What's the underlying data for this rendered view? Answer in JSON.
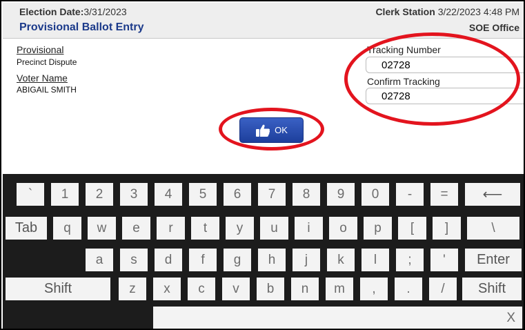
{
  "header": {
    "election_date_label": "Election Date:",
    "election_date_value": "3/31/2023",
    "title": "Provisional Ballot Entry",
    "station_label": "Clerk Station",
    "station_datetime": "3/22/2023 4:48 PM",
    "office": "SOE Office"
  },
  "details": {
    "provisional_label": "Provisional",
    "provisional_value": "Precinct Dispute",
    "voter_label": "Voter Name",
    "voter_value": "ABIGAIL SMITH"
  },
  "tracking": {
    "number_label": "Tracking Number",
    "number_value": "02728",
    "confirm_label": "Confirm Tracking",
    "confirm_value": "02728"
  },
  "ok_button": {
    "label": "OK",
    "icon": "thumbs-up-icon"
  },
  "annotation_color": "#e3141e",
  "keyboard": {
    "row1": [
      "`",
      "1",
      "2",
      "3",
      "4",
      "5",
      "6",
      "7",
      "8",
      "9",
      "0",
      "-",
      "=",
      "⟵"
    ],
    "row2": [
      "Tab",
      "q",
      "w",
      "e",
      "r",
      "t",
      "y",
      "u",
      "i",
      "o",
      "p",
      "[",
      "]",
      "\\"
    ],
    "row3": [
      "a",
      "s",
      "d",
      "f",
      "g",
      "h",
      "j",
      "k",
      "l",
      ";",
      "'",
      "Enter"
    ],
    "row4": [
      "Shift",
      "z",
      "x",
      "c",
      "v",
      "b",
      "n",
      "m",
      ",",
      ".",
      "/",
      "Shift"
    ],
    "row5": [
      "",
      "X"
    ]
  }
}
